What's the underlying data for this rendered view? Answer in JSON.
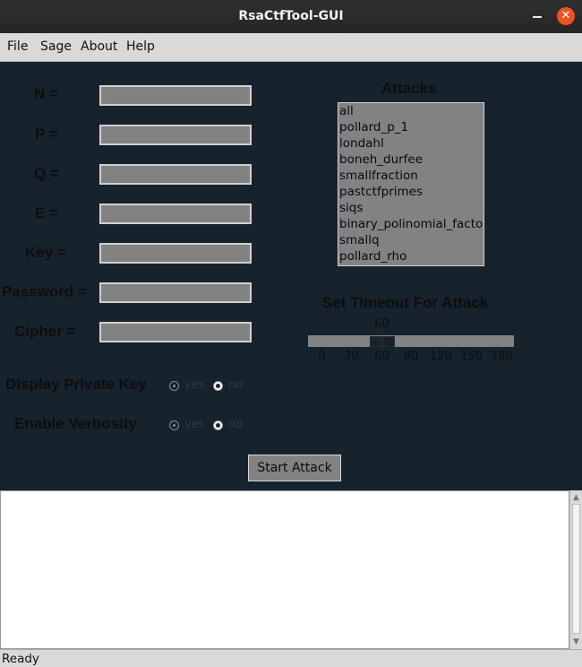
{
  "window": {
    "title": "RsaCtfTool-GUI"
  },
  "menu": {
    "items": [
      "File",
      "Sage",
      "About",
      "Help"
    ]
  },
  "form": {
    "fields": [
      {
        "label": "N =",
        "value": ""
      },
      {
        "label": "P =",
        "value": ""
      },
      {
        "label": "Q =",
        "value": ""
      },
      {
        "label": "E =",
        "value": ""
      },
      {
        "label": "Key =",
        "value": ""
      },
      {
        "label": "Password =",
        "value": ""
      },
      {
        "label": "Cipher =",
        "value": ""
      }
    ],
    "display_private_key": {
      "label": "Display Private Key",
      "yes": "yes",
      "no": "no",
      "selected": "no"
    },
    "enable_verbosity": {
      "label": "Enable Verbosity",
      "yes": "yes",
      "no": "no",
      "selected": "no"
    }
  },
  "attacks": {
    "title": "Attacks",
    "items": [
      "all",
      "pollard_p_1",
      "londahl",
      "boneh_durfee",
      "smallfraction",
      "pastctfprimes",
      "siqs",
      "binary_polinomial_factoring",
      "smallq",
      "pollard_rho"
    ]
  },
  "timeout": {
    "title": "Set Timeout For Attack",
    "value": "60",
    "min": 0,
    "max": 180,
    "ticks": [
      "0",
      "30",
      "60",
      "90",
      "120",
      "150",
      "180"
    ]
  },
  "actions": {
    "start_label": "Start Attack"
  },
  "output": {
    "text": ""
  },
  "status": {
    "text": "Ready"
  },
  "colors": {
    "background": "#16232c",
    "field": "#828282",
    "close_button": "#e95420"
  }
}
